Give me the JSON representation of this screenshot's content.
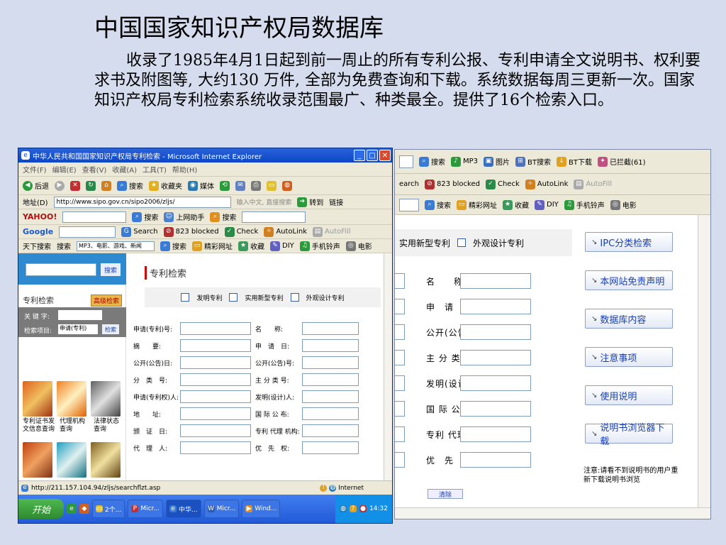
{
  "slide": {
    "title": "中国国家知识产权局数据库",
    "body": "收录了1985年4月1日起到前一周止的所有专利公报、专利申请全文说明书、权利要求书及附图等, 大约130 万件, 全部为免费查询和下载。系统数据每周三更新一次。国家知识产权局专利检索系统收录范围最广、种类最全。提供了16个检索入口。"
  },
  "back_window": {
    "toolbar1": [
      "搜索",
      "MP3",
      "图片",
      "BT搜索",
      "BT下载",
      "已拦截(61)"
    ],
    "toolbar2": [
      "earch",
      "823 blocked",
      "Check",
      "AutoLink",
      "AutoFill"
    ],
    "toolbar3": [
      "搜索",
      "精彩网址",
      "收藏",
      "DIY",
      "手机铃声",
      "电影"
    ],
    "patent_types": [
      "实用新型专利",
      "外观设计专利"
    ],
    "fields": [
      "名　　称:",
      "申　请　日:",
      "公开(公告)号:",
      "主 分 类 号:",
      "发明(设计)人:",
      "国 际 公 布:",
      "专利 代理 机构:",
      "优　先　权:"
    ],
    "side_buttons": [
      "IPC分类检索",
      "本网站免责声明",
      "数据库内容",
      "注意事项",
      "使用说明",
      "说明书浏览器下载"
    ],
    "note": "注意:请看不到说明书的用户重新下载说明书浏览",
    "bottom_button": "清除"
  },
  "front_window": {
    "title": "中华人民共和国国家知识产权局专利检索 - Microsoft Internet Explorer",
    "menu": [
      "文件(F)",
      "编辑(E)",
      "查看(V)",
      "收藏(A)",
      "工具(T)",
      "帮助(H)"
    ],
    "std_buttons": [
      "后退",
      "搜索",
      "收藏夹",
      "媒体"
    ],
    "address_label": "地址(D)",
    "address_url": "http://www.sipo.gov.cn/sipo2006/zljs/",
    "address_hint": "输入中文, 直接搜索",
    "go": "转到",
    "links": "链接",
    "yahoo": {
      "brand": "YAHOO!",
      "items": [
        "搜索",
        "上网助手",
        "搜索"
      ]
    },
    "google": {
      "brand": "Google",
      "items": [
        "Search",
        "823 blocked",
        "Check",
        "AutoLink",
        "AutoFill"
      ]
    },
    "sky": {
      "label": "天下搜索",
      "search_label": "搜索",
      "query": "MP3、电影、游戏、新闻",
      "items": [
        "搜索",
        "精彩网址",
        "收藏",
        "DIY",
        "手机铃声",
        "电影"
      ]
    },
    "left": {
      "search_btn": "搜索",
      "heading": "专利检索",
      "advanced": "高级检索",
      "keyword_label": "关 键 字:",
      "field_label": "检索项目:",
      "field_value": "申请(专利)",
      "go_btn": "检索",
      "tile_captions": [
        "专利证书发文信息查询",
        "代理机构查询",
        "法律状态查询"
      ]
    },
    "right": {
      "title": "专利检索",
      "types": [
        "发明专利",
        "实用新型专利",
        "外观设计专利"
      ],
      "fields_left": [
        "申请(专利)号:",
        "摘　　要:",
        "公开(公告)日:",
        "分　类　号:",
        "申请(专利权)人:",
        "地　　址:",
        "颁　证　日:",
        "代　理　人:"
      ],
      "fields_right": [
        "名　　称:",
        "申　请　日:",
        "公开(公告)号:",
        "主 分 类 号:",
        "发明(设计)人:",
        "国 际 公 布:",
        "专利 代理 机构:",
        "优　先　权:"
      ]
    },
    "status_url": "http://211.157.104.94/zljs/searchflzt.asp",
    "status_zone": "Internet"
  },
  "taskbar": {
    "start": "开始",
    "tasks": [
      "2个...",
      "Micr...",
      "中华...",
      "Micr...",
      "Wind..."
    ],
    "clock": "14:32"
  },
  "colors": {
    "accent": "#0a46c8",
    "slide_bg": "#d5dced",
    "link_blue": "#1a3fb0"
  }
}
